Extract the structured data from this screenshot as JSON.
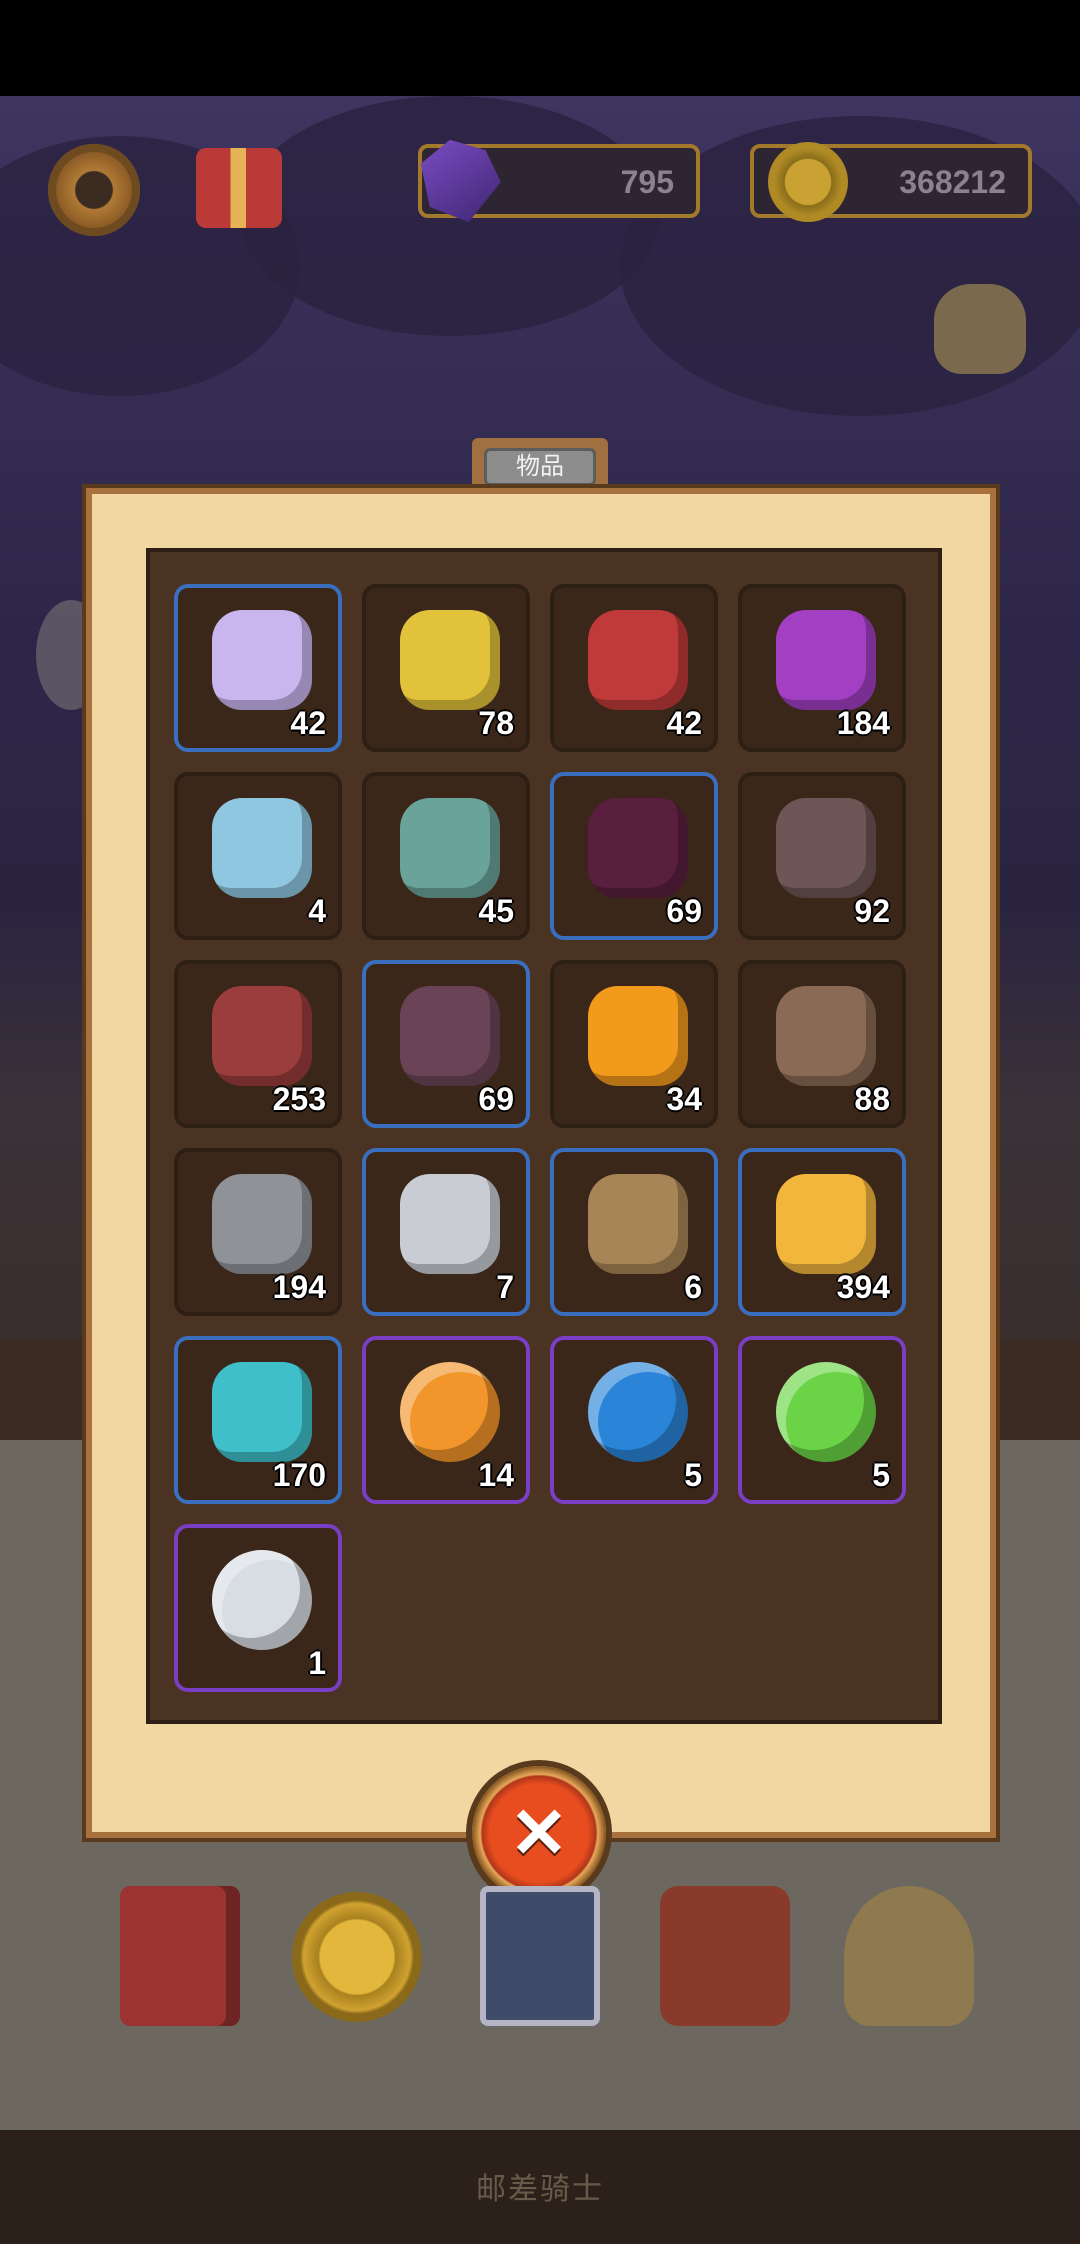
{
  "hud": {
    "gems": "795",
    "coins": "368212"
  },
  "panel": {
    "tab_label": "物品"
  },
  "items": [
    {
      "id": "crystal",
      "count": "42",
      "frame": "blue",
      "icon": "crystal-shard-icon",
      "color": "#c9b6ee"
    },
    {
      "id": "lava-stone",
      "count": "78",
      "frame": "none",
      "icon": "cracked-magma-stone-icon",
      "color": "#e2c23a"
    },
    {
      "id": "scrap-cloth",
      "count": "42",
      "frame": "none",
      "icon": "torn-cloth-icon",
      "color": "#c03a3a"
    },
    {
      "id": "poison-bowl",
      "count": "184",
      "frame": "none",
      "icon": "purple-potion-bowl-icon",
      "color": "#a23fc2"
    },
    {
      "id": "bubble-pouch",
      "count": "4",
      "frame": "none",
      "icon": "bubble-pouch-icon",
      "color": "#8fc7e0"
    },
    {
      "id": "mask",
      "count": "45",
      "frame": "none",
      "icon": "tribal-mask-icon",
      "color": "#6aa39a"
    },
    {
      "id": "hide",
      "count": "69",
      "frame": "blue",
      "icon": "animal-hide-icon",
      "color": "#5a1f3e"
    },
    {
      "id": "jar-empty",
      "count": "92",
      "frame": "none",
      "icon": "brown-jar-icon",
      "color": "#6e5656"
    },
    {
      "id": "jar-orange",
      "count": "253",
      "frame": "none",
      "icon": "red-log-orange-top-icon",
      "color": "#9b3d3d"
    },
    {
      "id": "jar-purple",
      "count": "69",
      "frame": "blue",
      "icon": "purple-jar-icon",
      "color": "#6a4456"
    },
    {
      "id": "jar-gold",
      "count": "34",
      "frame": "none",
      "icon": "golden-log-icon",
      "color": "#f29a1c"
    },
    {
      "id": "ore-brown",
      "count": "88",
      "frame": "none",
      "icon": "brown-ore-icon",
      "color": "#8a6a55"
    },
    {
      "id": "ore-gray",
      "count": "194",
      "frame": "none",
      "icon": "gray-ore-icon",
      "color": "#8f9398"
    },
    {
      "id": "ingot-silver",
      "count": "7",
      "frame": "blue",
      "icon": "silver-ingot-icon",
      "color": "#c9ccd2"
    },
    {
      "id": "ingot-bronze",
      "count": "6",
      "frame": "blue",
      "icon": "bronze-ingot-icon",
      "color": "#a88556"
    },
    {
      "id": "ore-gold",
      "count": "394",
      "frame": "blue",
      "icon": "gold-ore-icon",
      "color": "#f2b63c"
    },
    {
      "id": "ore-cyan",
      "count": "170",
      "frame": "blue",
      "icon": "cyan-ore-icon",
      "color": "#3fbfc9"
    },
    {
      "id": "orb-orange",
      "count": "14",
      "frame": "purple",
      "icon": "orange-orb-icon",
      "color": "#f2952a"
    },
    {
      "id": "orb-blue",
      "count": "5",
      "frame": "purple",
      "icon": "blue-orb-icon",
      "color": "#2a84d8"
    },
    {
      "id": "orb-green",
      "count": "5",
      "frame": "purple",
      "icon": "green-orb-icon",
      "color": "#6ad446"
    },
    {
      "id": "orb-white",
      "count": "1",
      "frame": "purple",
      "icon": "white-orb-icon",
      "color": "#d8dde3"
    }
  ],
  "footer": {
    "label": "邮差骑士"
  }
}
